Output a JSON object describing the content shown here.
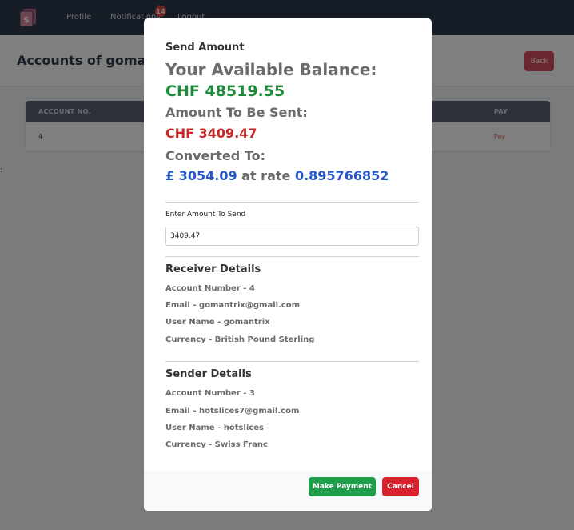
{
  "navbar": {
    "brand_icon": "wallet-logo-icon",
    "links": [
      "Profile",
      "Notifications",
      "Logout"
    ],
    "notification_count": "14"
  },
  "page": {
    "title": "Accounts of gomantrix",
    "back_label": "Back"
  },
  "table": {
    "headers": [
      "ACCOUNT NO.",
      "PAY"
    ],
    "rows": [
      {
        "account_no": "4",
        "pay": "Pay"
      }
    ]
  },
  "modal": {
    "title": "Send Amount",
    "balance_label": "Your Available Balance:",
    "balance_value": "CHF 48519.55",
    "sent_label": "Amount To Be Sent:",
    "sent_value": "CHF 3409.47",
    "converted_label": "Converted To:",
    "converted_value": "£ 3054.09",
    "rate_text": "at rate",
    "rate_value": "0.895766852",
    "input_label": "Enter Amount To Send",
    "input_value": "3409.47",
    "receiver": {
      "title": "Receiver Details",
      "account": "Account Number - 4",
      "email": "Email - gomantrix@gmail.com",
      "username": "User Name - gomantrix",
      "currency": "Currency - British Pound Sterling"
    },
    "sender": {
      "title": "Sender Details",
      "account": "Account Number - 3",
      "email": "Email - hotslices7@gmail.com",
      "username": "User Name - hotslices",
      "currency": "Currency - Swiss Franc"
    },
    "pay_button": "Make Payment",
    "cancel_button": "Cancel"
  },
  "colors": {
    "balance": "#1f8a3a",
    "sent": "#c62828",
    "converted": "#2557c8",
    "pay_button": "#1f9d4a",
    "cancel_button": "#d7222d"
  }
}
